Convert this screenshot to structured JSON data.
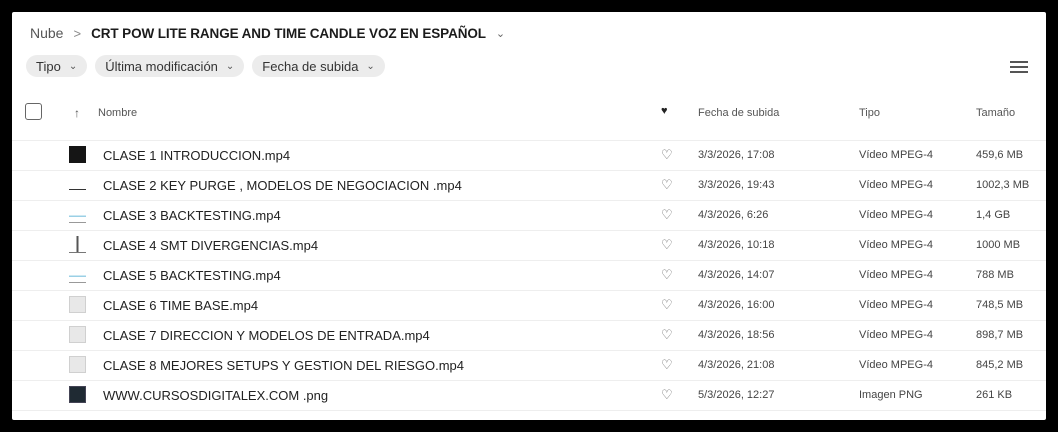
{
  "breadcrumb": {
    "root": "Nube",
    "separator": ">",
    "current": "CRT POW LITE RANGE AND TIME CANDLE VOZ EN ESPAÑOL"
  },
  "filters": [
    {
      "label": "Tipo"
    },
    {
      "label": "Última modificación"
    },
    {
      "label": "Fecha de subida"
    }
  ],
  "columns": {
    "name": "Nombre",
    "date": "Fecha de subida",
    "type": "Tipo",
    "size": "Tamaño"
  },
  "files": [
    {
      "name": "CLASE 1 INTRODUCCION.mp4",
      "date": "3/3/2026, 17:08",
      "type": "Vídeo MPEG-4",
      "size": "459,6 MB",
      "thumb": "dark"
    },
    {
      "name": "CLASE 2 KEY PURGE , MODELOS DE NEGOCIACION .mp4",
      "date": "3/3/2026, 19:43",
      "type": "Vídeo MPEG-4",
      "size": "1002,3 MB",
      "thumb": "line"
    },
    {
      "name": "CLASE 3 BACKTESTING.mp4",
      "date": "4/3/2026, 6:26",
      "type": "Vídeo MPEG-4",
      "size": "1,4 GB",
      "thumb": "chartish"
    },
    {
      "name": "CLASE 4 SMT DIVERGENCIAS.mp4",
      "date": "4/3/2026, 10:18",
      "type": "Vídeo MPEG-4",
      "size": "1000 MB",
      "thumb": "bar"
    },
    {
      "name": "CLASE 5 BACKTESTING.mp4",
      "date": "4/3/2026, 14:07",
      "type": "Vídeo MPEG-4",
      "size": "788 MB",
      "thumb": "chartish"
    },
    {
      "name": "CLASE 6 TIME BASE.mp4",
      "date": "4/3/2026, 16:00",
      "type": "Vídeo MPEG-4",
      "size": "748,5 MB",
      "thumb": "light"
    },
    {
      "name": "CLASE 7 DIRECCION Y MODELOS DE ENTRADA.mp4",
      "date": "4/3/2026, 18:56",
      "type": "Vídeo MPEG-4",
      "size": "898,7 MB",
      "thumb": "light"
    },
    {
      "name": "CLASE 8 MEJORES SETUPS Y GESTION DEL RIESGO.mp4",
      "date": "4/3/2026, 21:08",
      "type": "Vídeo MPEG-4",
      "size": "845,2 MB",
      "thumb": "light"
    },
    {
      "name": "WWW.CURSOSDIGITALEX.COM .png",
      "date": "5/3/2026, 12:27",
      "type": "Imagen PNG",
      "size": "261 KB",
      "thumb": "dark2"
    }
  ],
  "icons": {
    "sort": "arrow-up-icon",
    "favorite_header": "heart-filled-icon",
    "favorite_row": "heart-outline-icon",
    "view_toggle": "list-view-icon"
  }
}
